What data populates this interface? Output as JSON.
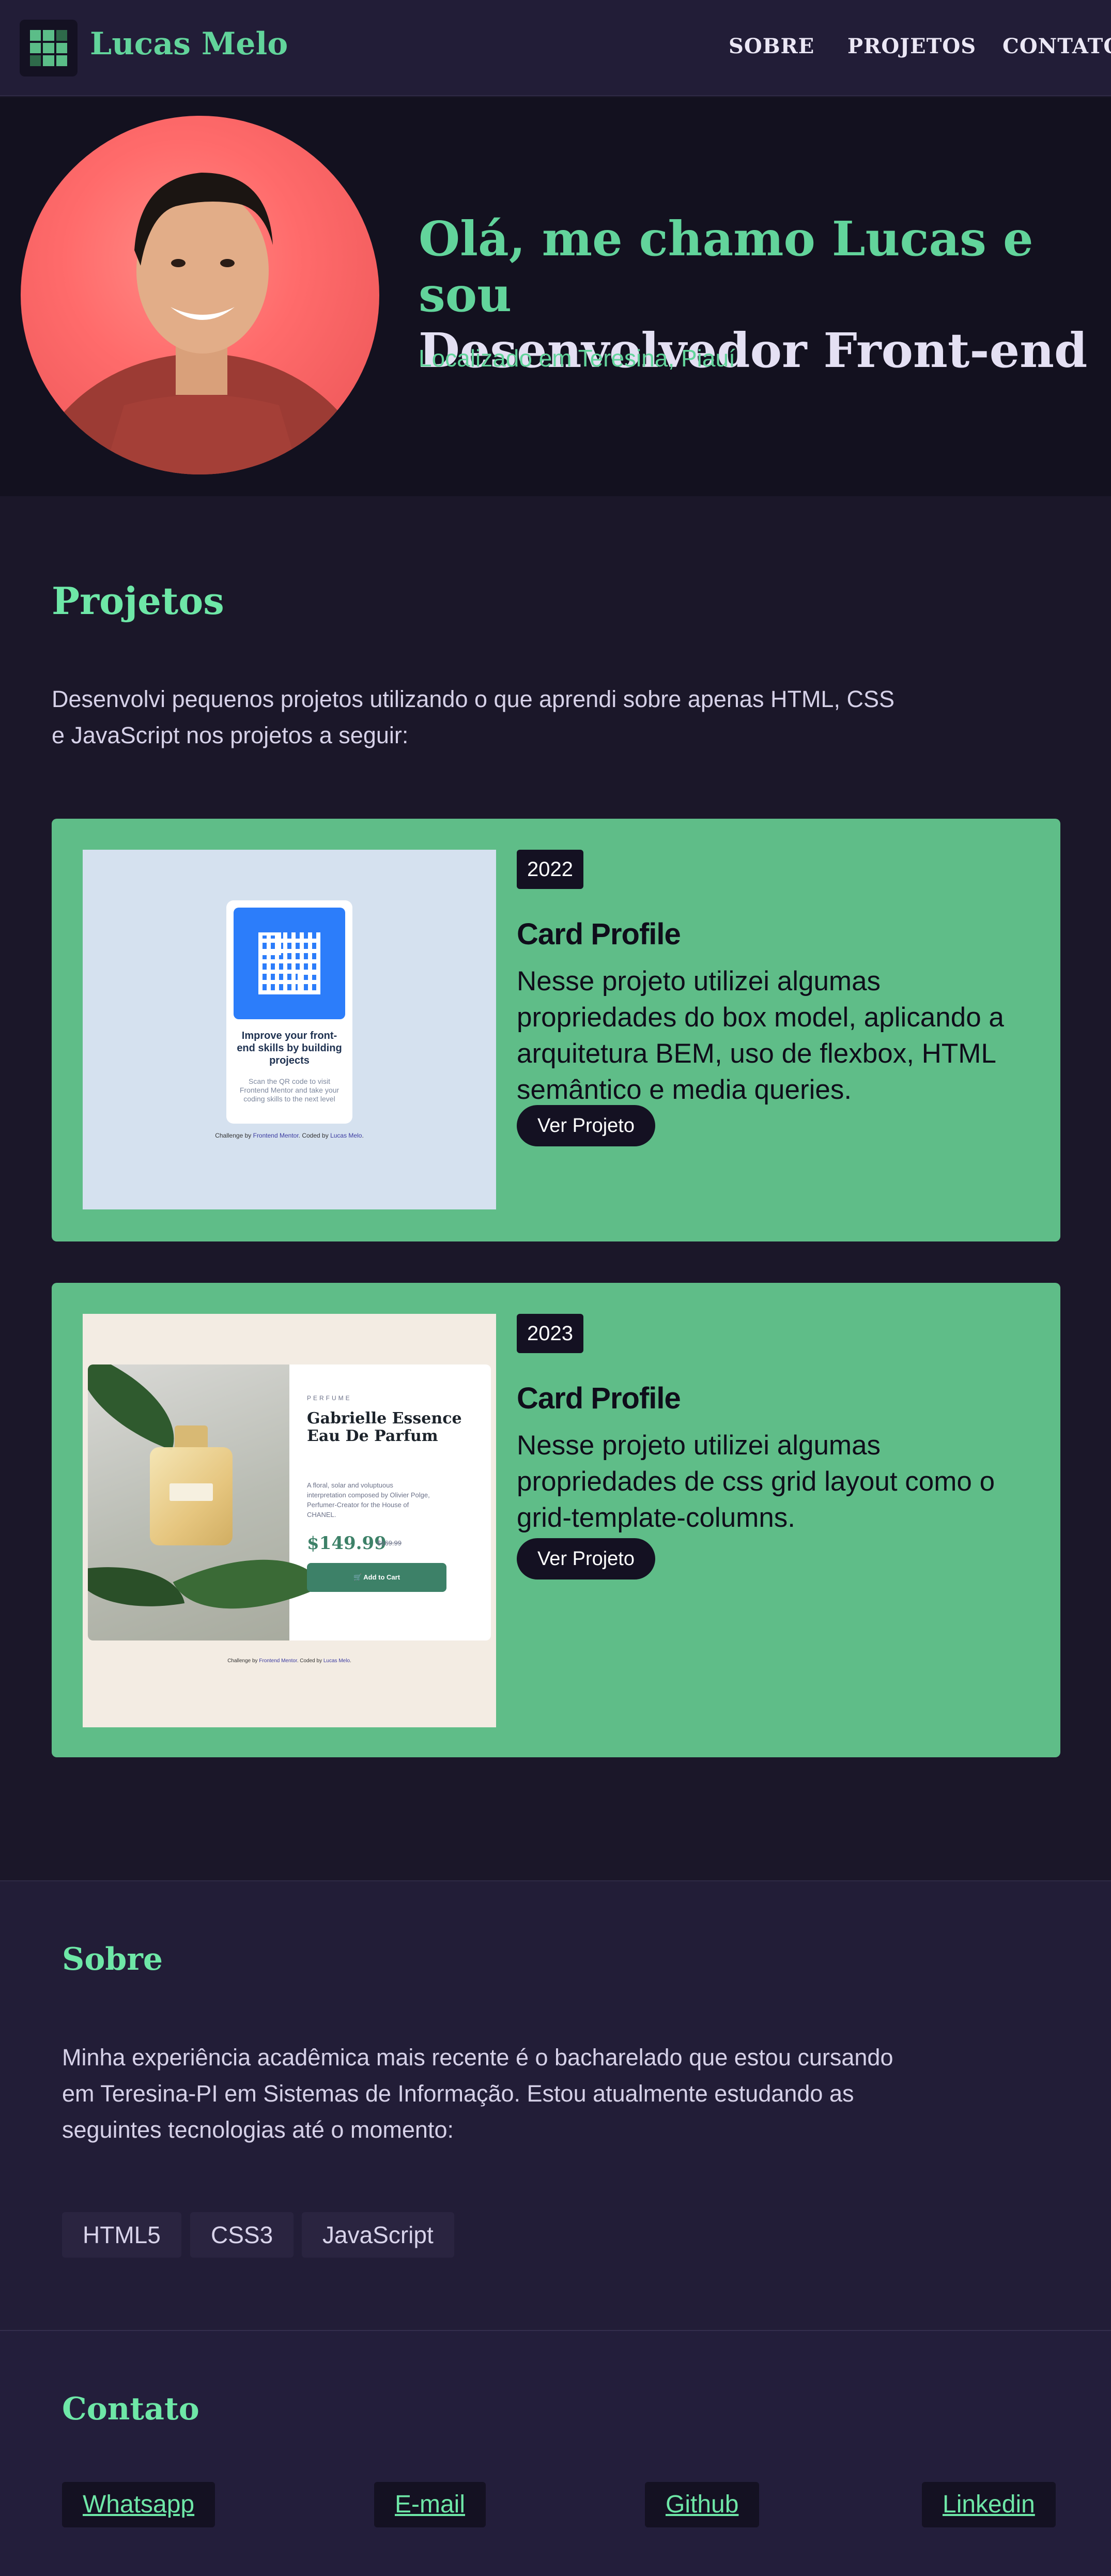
{
  "header": {
    "brand": "Lucas Melo",
    "nav": [
      "SOBRE",
      "PROJETOS",
      "CONTATO"
    ]
  },
  "hero": {
    "title_line1": "Olá, me chamo Lucas e sou",
    "title_line2": "Desenvolvedor Front-end",
    "subtitle": "Localizado em Teresina, Piauí"
  },
  "projects": {
    "title": "Projetos",
    "description": "Desenvolvi pequenos projetos utilizando o que aprendi sobre apenas HTML, CSS e JavaScript nos projetos a seguir:",
    "items": [
      {
        "year": "2022",
        "title": "Card Profile",
        "text": "Nesse projeto utilizei algumas propriedades do box model, aplicando a arquitetura BEM, uso de flexbox, HTML semântico e media queries.",
        "button": "Ver Projeto",
        "preview": {
          "heading": "Improve your front-end skills by building projects",
          "text": "Scan the QR code to visit Frontend Mentor and take your coding skills to the next level",
          "attr_prefix": "Challenge by",
          "attr_link1": "Frontend Mentor",
          "attr_mid": ". Coded by",
          "attr_link2": "Lucas Melo",
          "attr_end": "."
        }
      },
      {
        "year": "2023",
        "title": "Card Profile",
        "text": "Nesse projeto utilizei algumas propriedades de css grid layout como o grid-template-columns.",
        "button": "Ver Projeto",
        "preview": {
          "category": "PERFUME",
          "name": "Gabrielle Essence Eau De Parfum",
          "desc": "A floral, solar and voluptuous interpretation composed by Olivier Polge, Perfumer-Creator for the House of CHANEL.",
          "price": "$149.99",
          "old_price": "$169.99",
          "cart_button": "Add to Cart",
          "attr_prefix": "Challenge by",
          "attr_link1": "Frontend Mentor",
          "attr_mid": ". Coded by",
          "attr_link2": "Lucas Melo",
          "attr_end": "."
        }
      }
    ]
  },
  "about": {
    "title": "Sobre",
    "description": "Minha experiência acadêmica mais recente é o bacharelado que estou cursando em Teresina-PI em Sistemas de Informação. Estou atualmente estudando as seguintes tecnologias até o momento:",
    "tags": [
      "HTML5",
      "CSS3",
      "JavaScript"
    ]
  },
  "contact": {
    "title": "Contato",
    "links": [
      "Whatsapp",
      "E-mail",
      "Github",
      "Linkedin"
    ]
  },
  "colors": {
    "accent": "#6ee7a7",
    "card": "#5fbd88",
    "background": "#1b1729",
    "header": "#221d37"
  }
}
